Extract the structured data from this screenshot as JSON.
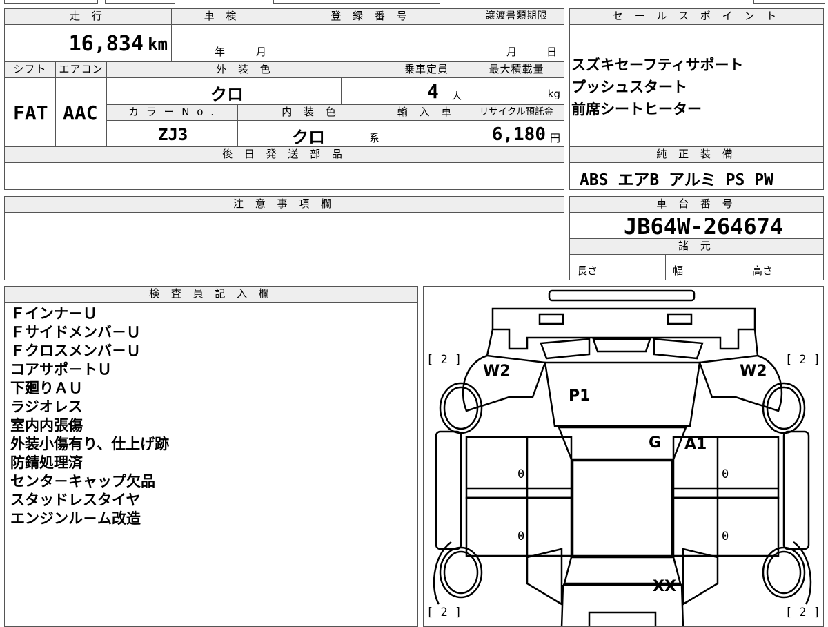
{
  "top": {
    "mileage_header": "走 行",
    "mileage_value": "16,834",
    "mileage_unit": "km",
    "shaken_header": "車 検",
    "shaken_year": "年",
    "shaken_month": "月",
    "reg_header": "登 録 番 号",
    "transfer_header": "譲渡書類期限",
    "transfer_month": "月",
    "transfer_day": "日",
    "shift_header": "シフト",
    "shift_value": "FAT",
    "ac_header": "エアコン",
    "ac_value": "AAC",
    "exterior_header": "外 装 色",
    "exterior_value": "クロ",
    "capacity_header": "乗車定員",
    "capacity_value": "4",
    "capacity_unit": "人",
    "load_header": "最大積載量",
    "load_unit": "kg",
    "color_no_header": "カ ラ ー N o .",
    "color_no_value": "ZJ3",
    "interior_header": "内 装 色",
    "interior_value": "クロ",
    "interior_suffix": "系",
    "import_header": "輸 入 車",
    "recycle_header": "リサイクル預託金",
    "recycle_value": "6,180",
    "recycle_unit": "円",
    "later_parts_header": "後 日 発 送 部 品"
  },
  "sales": {
    "header": "セ ー ル ス ポ イ ン ト",
    "lines": [
      "スズキセーフティサポート",
      "プッシュスタート",
      "前席シートヒーター"
    ]
  },
  "equipment": {
    "header": "純 正 装 備",
    "value": "ABS エアB アルミ PS PW"
  },
  "notes": {
    "header": "注 意 事 項 欄"
  },
  "chassis": {
    "header": "車 台 番 号",
    "value": "JB64W-264674",
    "spec_header": "諸 元",
    "length": "長さ",
    "width": "幅",
    "height": "高さ"
  },
  "inspector": {
    "header": "検 査 員 記 入 欄",
    "lines": [
      "Ｆインナ－Ｕ",
      "Ｆサイドメンバ－Ｕ",
      "Ｆクロスメンバ－Ｕ",
      "コアサポ－トＵ",
      "下廻りＡＵ",
      "ラジオレス",
      "室内内張傷",
      "外装小傷有り、仕上げ跡",
      "防錆処理済",
      "センタ－キャップ欠品",
      "スタッドレスタイヤ",
      "エンジンル－ム改造"
    ]
  },
  "diagram": {
    "tire_fl": "[ 2 ]",
    "tire_fr": "[ 2 ]",
    "tire_rl": "[ 2 ]",
    "tire_rr": "[ 2 ]",
    "w2_left": "W2",
    "w2_right": "W2",
    "p1": "P1",
    "g": "G",
    "a1": "A1",
    "zero_1": "0",
    "zero_2": "0",
    "zero_3": "0",
    "zero_4": "0",
    "xx": "XX"
  }
}
